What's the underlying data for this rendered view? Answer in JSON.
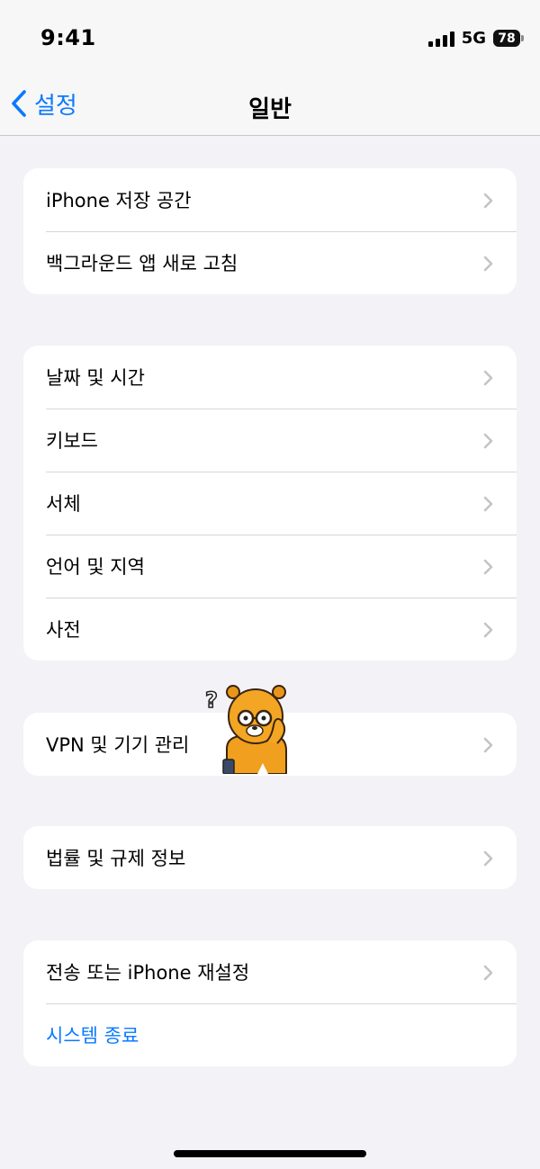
{
  "status_bar": {
    "time": "9:41",
    "network": "5G",
    "battery": "78"
  },
  "nav": {
    "back_label": "설정",
    "title": "일반"
  },
  "groups": [
    {
      "items": [
        {
          "label": "iPhone 저장 공간"
        },
        {
          "label": "백그라운드 앱 새로 고침"
        }
      ]
    },
    {
      "items": [
        {
          "label": "날짜 및 시간"
        },
        {
          "label": "키보드"
        },
        {
          "label": "서체"
        },
        {
          "label": "언어 및 지역"
        },
        {
          "label": "사전"
        }
      ]
    },
    {
      "items": [
        {
          "label": "VPN 및 기기 관리"
        }
      ]
    },
    {
      "items": [
        {
          "label": "법률 및 규제 정보"
        }
      ]
    },
    {
      "items": [
        {
          "label": "전송 또는 iPhone 재설정"
        },
        {
          "label": "시스템 종료"
        }
      ]
    }
  ],
  "colors": {
    "accent": "#0a7aff",
    "background": "#f2f2f7",
    "chevron": "#c4c4c7"
  },
  "icons": {
    "back": "chevron-left-icon",
    "disclosure": "chevron-right-icon",
    "signal": "cellular-signal-icon",
    "battery": "battery-icon",
    "sticker": "bear-sticker"
  }
}
